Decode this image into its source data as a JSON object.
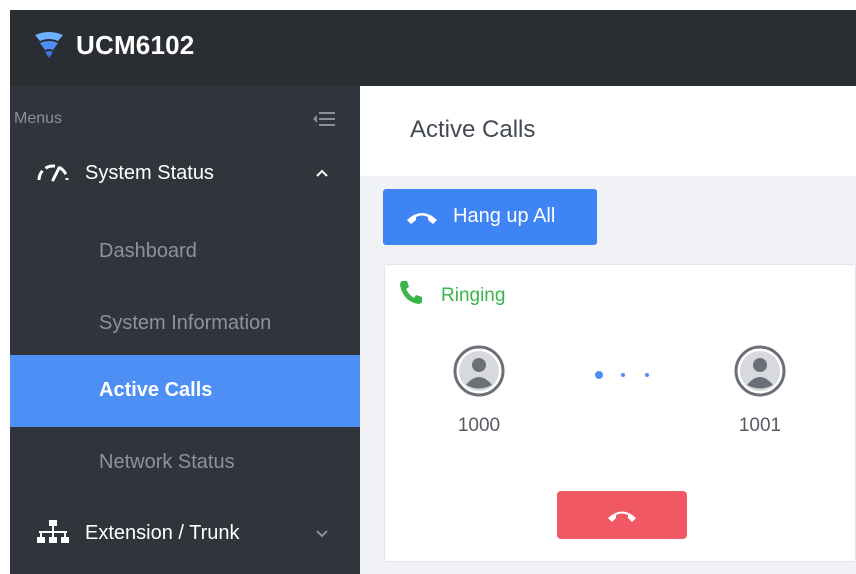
{
  "app": {
    "brand": "UCM6102"
  },
  "sidebar": {
    "menus_label": "Menus",
    "groups": [
      {
        "label": "System Status",
        "icon": "gauge-icon",
        "expanded": true
      },
      {
        "label": "Extension / Trunk",
        "icon": "network-tree-icon",
        "expanded": false
      }
    ],
    "system_status_items": [
      {
        "label": "Dashboard",
        "active": false
      },
      {
        "label": "System Information",
        "active": false
      },
      {
        "label": "Active Calls",
        "active": true
      },
      {
        "label": "Network Status",
        "active": false
      }
    ]
  },
  "content": {
    "title": "Active Calls",
    "hangup_all_label": "Hang up All",
    "call": {
      "status": "Ringing",
      "caller": "1000",
      "callee": "1001"
    }
  },
  "colors": {
    "topbar": "#2a2e33",
    "sidebar": "#30343b",
    "accent_blue": "#4d8ff5",
    "button_blue": "#3e84f4",
    "ringing_green": "#3ab54a",
    "hangup_red": "#f05864"
  }
}
